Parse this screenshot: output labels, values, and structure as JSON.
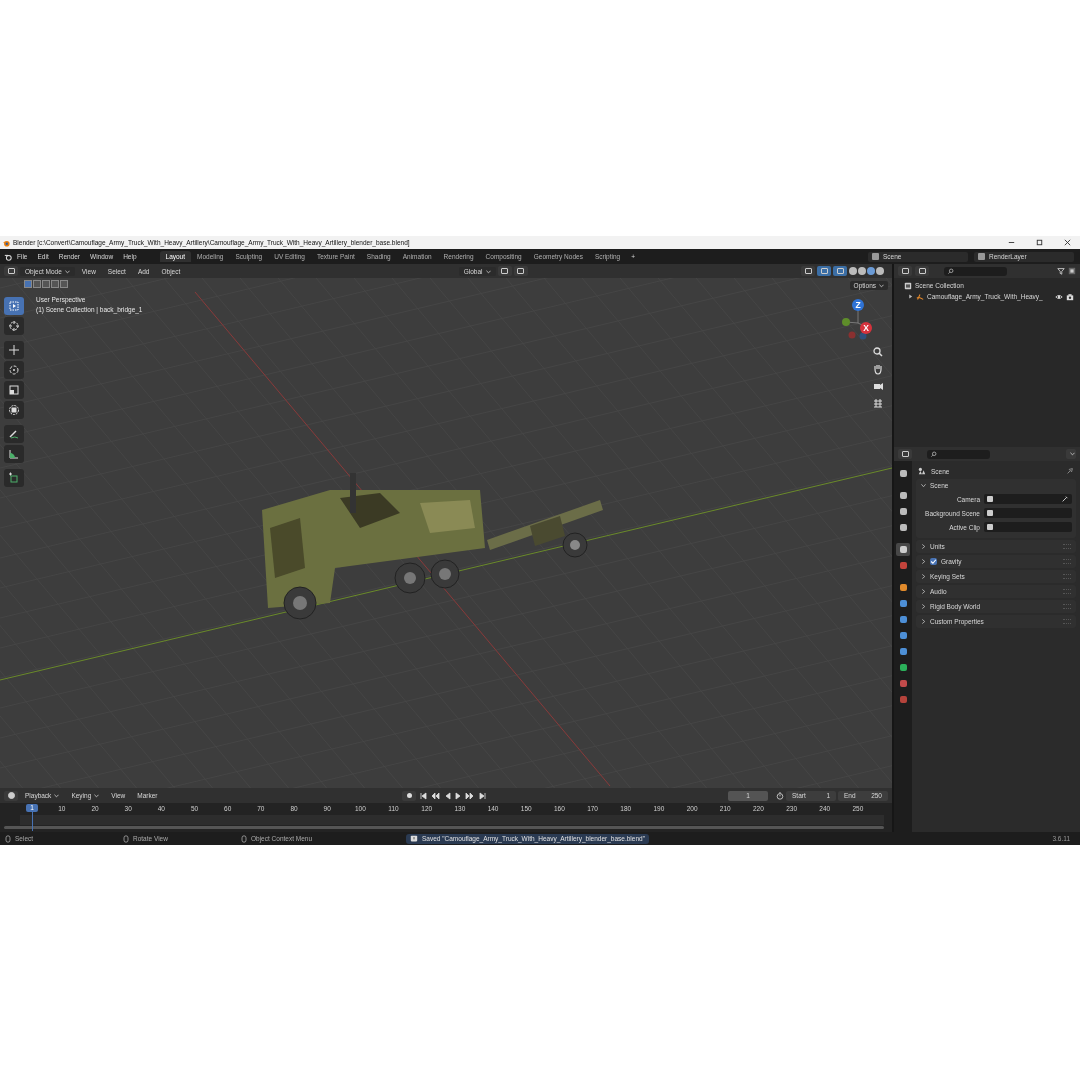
{
  "window": {
    "title": "Blender [c:\\Convert\\Camouflage_Army_Truck_With_Heavy_Artillery\\Camouflage_Army_Truck_With_Heavy_Artillery_blender_base.blend]"
  },
  "menu": [
    "File",
    "Edit",
    "Render",
    "Window",
    "Help"
  ],
  "workspaces": [
    {
      "label": "Layout",
      "selected": true
    },
    {
      "label": "Modeling",
      "selected": false
    },
    {
      "label": "Sculpting",
      "selected": false
    },
    {
      "label": "UV Editing",
      "selected": false
    },
    {
      "label": "Texture Paint",
      "selected": false
    },
    {
      "label": "Shading",
      "selected": false
    },
    {
      "label": "Animation",
      "selected": false
    },
    {
      "label": "Rendering",
      "selected": false
    },
    {
      "label": "Compositing",
      "selected": false
    },
    {
      "label": "Geometry Nodes",
      "selected": false
    },
    {
      "label": "Scripting",
      "selected": false
    }
  ],
  "add_workspace": "+",
  "scene": "Scene",
  "view_layer": "RenderLayer",
  "viewport": {
    "mode": "Object Mode",
    "menus": [
      "View",
      "Select",
      "Add",
      "Object"
    ],
    "orientation": "Global",
    "options": "Options",
    "overlay_text": [
      "User Perspective",
      "(1) Scene Collection | back_bridge_1"
    ],
    "gizmo_labels": [
      "Z",
      "X"
    ],
    "tools": [
      {
        "kind": "select",
        "selected": true
      },
      {
        "kind": "cursor",
        "selected": false
      },
      {
        "kind": "move",
        "selected": false
      },
      {
        "kind": "rotate",
        "selected": false
      },
      {
        "kind": "scale",
        "selected": false
      },
      {
        "kind": "transform",
        "selected": false
      },
      {
        "kind": "annotate",
        "selected": false
      },
      {
        "kind": "measure",
        "selected": false
      },
      {
        "kind": "add-cube",
        "selected": false
      }
    ]
  },
  "outliner": {
    "items": [
      {
        "label": "Scene Collection",
        "children": [
          {
            "label": "Camouflage_Army_Truck_With_Heavy_",
            "expanded": false
          }
        ]
      }
    ]
  },
  "properties": {
    "title": "Scene",
    "tabs": [
      {
        "kind": "tool",
        "selected": false
      },
      {
        "kind": "render",
        "selected": false
      },
      {
        "kind": "output",
        "selected": false
      },
      {
        "kind": "view-layer",
        "selected": false
      },
      {
        "kind": "scene",
        "selected": true
      },
      {
        "kind": "world",
        "selected": false
      },
      {
        "kind": "object",
        "selected": false
      },
      {
        "kind": "modifiers",
        "selected": false
      },
      {
        "kind": "particles",
        "selected": false
      },
      {
        "kind": "physics",
        "selected": false
      },
      {
        "kind": "constraints",
        "selected": false
      },
      {
        "kind": "data",
        "selected": false
      },
      {
        "kind": "material",
        "selected": false
      },
      {
        "kind": "texture",
        "selected": false
      }
    ],
    "panel": {
      "label": "Scene",
      "expanded": true,
      "fields": [
        {
          "label": "Camera",
          "kind": "camera"
        },
        {
          "label": "Background Scene",
          "kind": "scene"
        },
        {
          "label": "Active Clip",
          "kind": "clip"
        }
      ]
    },
    "sections": [
      {
        "label": "Units",
        "kind": "plain"
      },
      {
        "label": "Gravity",
        "kind": "checkbox",
        "checked": true
      },
      {
        "label": "Keying Sets",
        "kind": "plain"
      },
      {
        "label": "Audio",
        "kind": "plain"
      },
      {
        "label": "Rigid Body World",
        "kind": "plain"
      },
      {
        "label": "Custom Properties",
        "kind": "plain"
      }
    ]
  },
  "timeline": {
    "menus": [
      "Playback",
      "Keying",
      "View",
      "Marker"
    ],
    "current_frame": "1",
    "start_label": "Start",
    "start": "1",
    "end_label": "End",
    "end": "250",
    "playhead": "1",
    "ticks": [
      "10",
      "20",
      "30",
      "40",
      "50",
      "60",
      "70",
      "80",
      "90",
      "100",
      "110",
      "120",
      "130",
      "140",
      "150",
      "160",
      "170",
      "180",
      "190",
      "200",
      "210",
      "220",
      "230",
      "240",
      "250"
    ]
  },
  "status_bar": {
    "hints": [
      "Select",
      "Rotate View",
      "Object Context Menu"
    ],
    "message": "Saved \"Camouflage_Army_Truck_With_Heavy_Artillery_blender_base.blend\"",
    "version": "3.6.11"
  }
}
